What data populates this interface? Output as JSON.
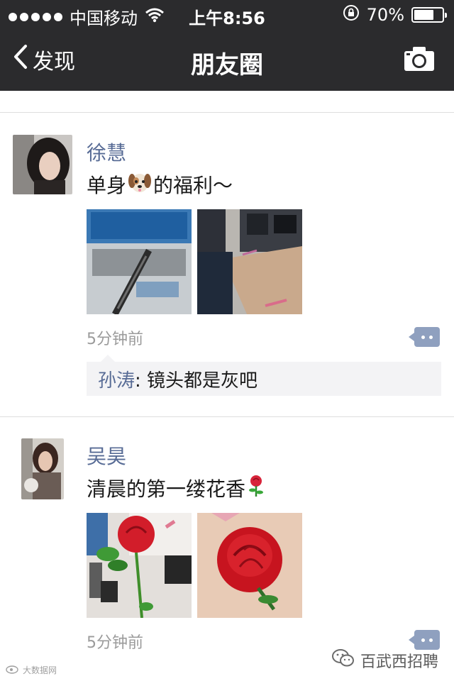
{
  "status_bar": {
    "carrier": "中国移动",
    "time": "上午8:56",
    "battery_text": "70%",
    "battery_level": 0.7
  },
  "nav": {
    "back_label": "发现",
    "title": "朋友圈"
  },
  "posts": [
    {
      "name": "徐慧",
      "text_before": "单身",
      "text_after": "的福利～",
      "time": "5分钟前",
      "comments": [
        {
          "author": "孙涛",
          "text": ": 镜头都是灰吧"
        }
      ]
    },
    {
      "name": "吴昊",
      "text": "清晨的第一缕花香",
      "time": "5分钟前"
    }
  ],
  "watermark": {
    "right_text": "百武西招聘",
    "left_text": "大数据网"
  },
  "colors": {
    "bar_background": "#2b2b2d",
    "name_link": "#576b95",
    "comment_bg": "#f3f3f5",
    "meta_text": "#9b9b9b"
  },
  "icons": [
    "signal-dots-icon",
    "wifi-icon",
    "rotation-lock-icon",
    "battery-icon",
    "back-chevron-icon",
    "camera-icon",
    "dog-emoji-icon",
    "rose-emoji-icon",
    "comment-icon",
    "wechat-logo-icon"
  ]
}
